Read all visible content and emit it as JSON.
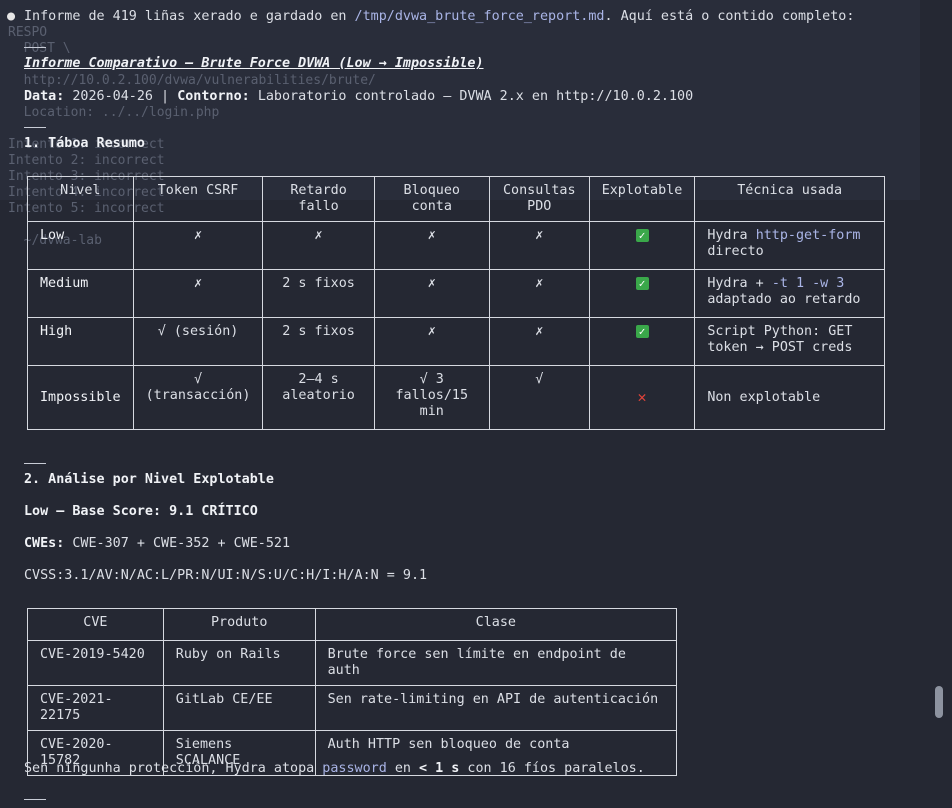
{
  "intro": {
    "prefix": "Informe de 419 liñas xerado e gardado en ",
    "path": "/tmp/dvwa_brute_force_report.md",
    "suffix": ". Aquí está o contido completo:"
  },
  "report": {
    "title": "Informe Comparativo — Brute Force DVWA (Low → Impossible)",
    "date_label": "Data:",
    "date_value": "2026-04-26",
    "sep": " | ",
    "env_label": "Contorno:",
    "env_value": "Laboratorio controlado — DVWA 2.x en http://10.0.2.100"
  },
  "summary": {
    "heading": "1. Táboa Resumo",
    "headers": [
      "Nivel",
      "Token CSRF",
      "Retardo fallo",
      "Bloqueo conta",
      "Consultas PDO",
      "Explotable",
      "Técnica usada"
    ],
    "rows": [
      {
        "level": "Low",
        "csrf": "✗",
        "delay": "✗",
        "lock": "✗",
        "pdo": "✗",
        "exploitable": "yes",
        "tech_a": "Hydra ",
        "tech_code": "http-get-form",
        "tech_b": " directo"
      },
      {
        "level": "Medium",
        "csrf": "✗",
        "delay": "2 s fixos",
        "lock": "✗",
        "pdo": "✗",
        "exploitable": "yes",
        "tech_a": "Hydra + ",
        "tech_code": "-t 1 -w 3",
        "tech_b": " adaptado ao retardo"
      },
      {
        "level": "High",
        "csrf": "√ (sesión)",
        "delay": "2 s fixos",
        "lock": "✗",
        "pdo": "✗",
        "exploitable": "yes",
        "tech_a": "Script Python: GET token → POST creds",
        "tech_code": "",
        "tech_b": ""
      },
      {
        "level": "Impossible",
        "csrf": "√ (transacción)",
        "delay": "2–4 s aleatorio",
        "lock": "√ 3 fallos/15 min",
        "pdo": "√",
        "exploitable": "no",
        "tech_a": "Non explotable",
        "tech_code": "",
        "tech_b": ""
      }
    ]
  },
  "analysis": {
    "heading": "2. Análise por Nivel Explotable",
    "low_title": "Low — Base Score: 9.1 CRÍTICO",
    "cwes_label": "CWEs:",
    "cwes_value": " CWE-307 + CWE-352 + CWE-521",
    "cvss": "CVSS:3.1/AV:N/AC:L/PR:N/UI:N/S:U/C:H/I:H/A:N = 9.1",
    "cve_headers": [
      "CVE",
      "Produto",
      "Clase"
    ],
    "cves": [
      {
        "cve": "CVE-2019-5420",
        "product": "Ruby on Rails",
        "class": "Brute force sen límite en endpoint de auth"
      },
      {
        "cve": "CVE-2021-22175",
        "product": "GitLab CE/EE",
        "class": "Sen rate-limiting en API de autenticación"
      },
      {
        "cve": "CVE-2020-15782",
        "product": "Siemens SCALANCE",
        "class": "Auth HTTP sen bloqueo de conta"
      }
    ],
    "note_a": "Sen ningunha protección, Hydra atopa ",
    "note_code": "password",
    "note_b": " en ",
    "note_bold": "< 1 s",
    "note_c": " con 16 fíos paralelos."
  },
  "ghost_lines": [
    "RESPO",
    "  POST \\",
    "  http://10.0.2.100/dvwa/vulnerabilities/brute/",
    "  Location: ../../login.php",
    "Intento 1: incorrect",
    "Intento 2: incorrect",
    "Intento 3: incorrect",
    "Intento 4: incorrect",
    "Intento 5: incorrect",
    "  ~/dvwa-lab"
  ]
}
